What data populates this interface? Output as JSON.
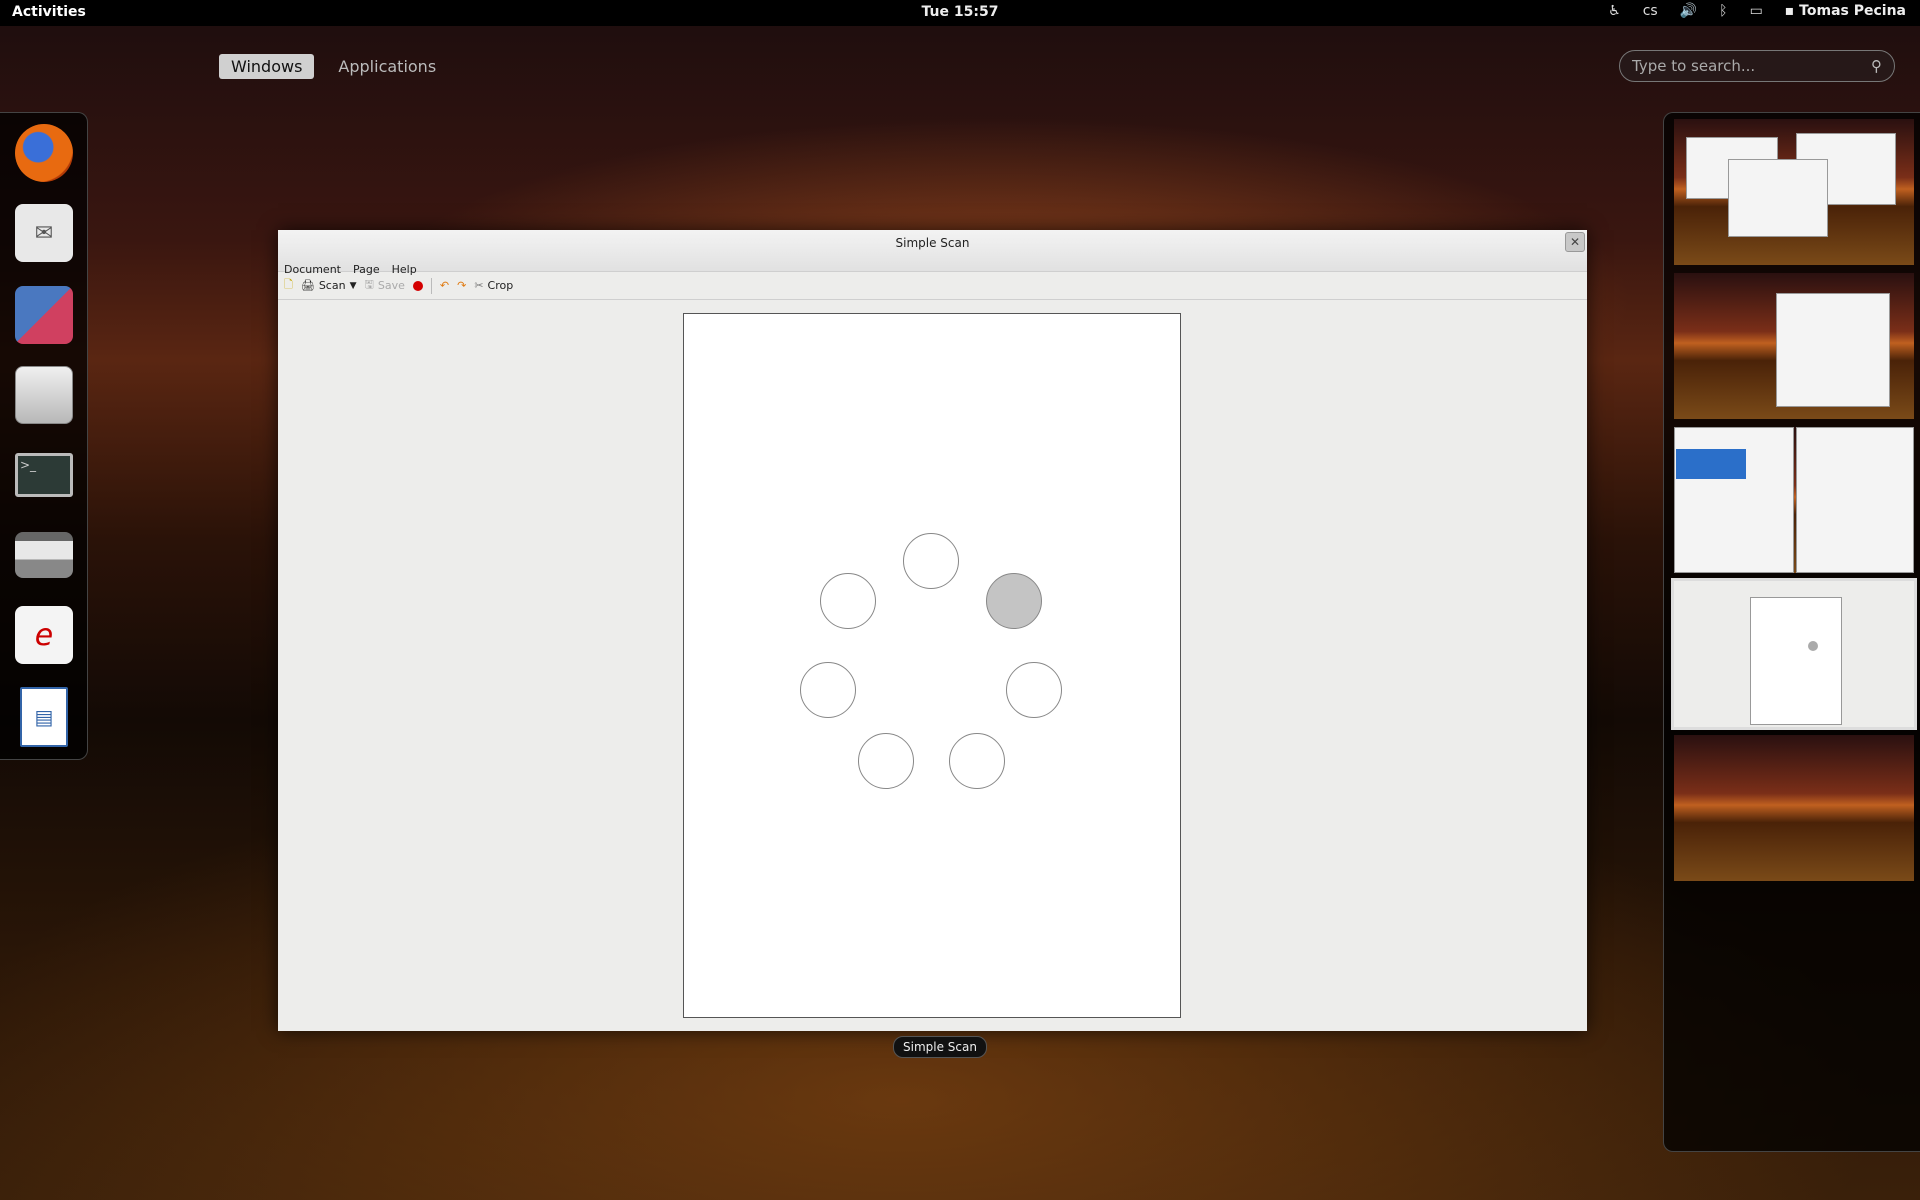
{
  "top_bar": {
    "activities": "Activities",
    "clock": "Tue 15:57",
    "keyboard_layout": "cs",
    "user_name": "Tomas Pecina"
  },
  "overview": {
    "tabs": [
      {
        "label": "Windows",
        "active": true
      },
      {
        "label": "Applications",
        "active": false
      }
    ],
    "search": {
      "placeholder": "Type to search..."
    }
  },
  "dash": {
    "apps": [
      {
        "name": "firefox",
        "icon": "firefox-icon"
      },
      {
        "name": "mail-clock",
        "icon": "mail-clock-icon"
      },
      {
        "name": "photos",
        "icon": "photos-icon"
      },
      {
        "name": "files",
        "icon": "file-cabinet-icon"
      },
      {
        "name": "terminal",
        "icon": "terminal-icon"
      },
      {
        "name": "scanner",
        "icon": "scanner-icon"
      },
      {
        "name": "pdf-viewer",
        "icon": "pdf-viewer-icon"
      },
      {
        "name": "document-writer",
        "icon": "writer-document-icon"
      }
    ]
  },
  "window": {
    "title": "Simple Scan",
    "menu": [
      "Document",
      "Page",
      "Help"
    ],
    "toolbar": {
      "scan_label": "Scan",
      "save_label": "Save",
      "crop_label": "Crop"
    },
    "caption": "Simple Scan",
    "spinner_active_index": 1
  },
  "workspaces": {
    "count": 5,
    "active_index": 3
  },
  "colors": {
    "active_tab_bg": "#d0d0d0",
    "window_bg": "#ededeb",
    "record_red": "#d40000",
    "rotate_orange": "#e07a10"
  }
}
